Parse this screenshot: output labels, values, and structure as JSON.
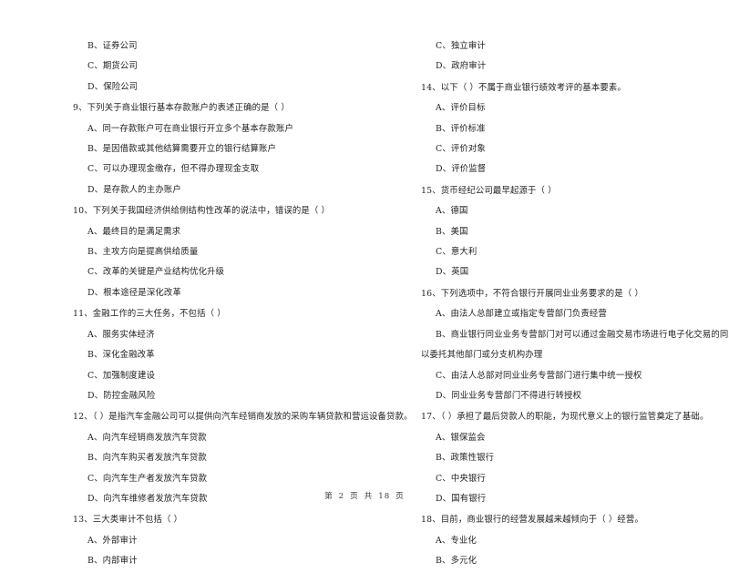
{
  "document": {
    "page_footer": {
      "prefix": "第",
      "current_page": "2",
      "unit_1": "页",
      "middle": "共",
      "total_pages": "18",
      "unit_2": "页"
    }
  },
  "left_column": {
    "orphan_options": [
      "B、证券公司",
      "C、期货公司",
      "D、保险公司"
    ],
    "questions": [
      {
        "number": "9、",
        "stem": "下列关于商业银行基本存款账户的表述正确的是（       ）",
        "options": [
          "A、同一存款账户可在商业银行开立多个基本存款账户",
          "B、是因借款或其他结算需要开立的银行结算账户",
          "C、可以办理现金缴存，但不得办理现金支取",
          "D、是存款人的主办账户"
        ]
      },
      {
        "number": "10、",
        "stem": "下列关于我国经济供给侧结构性改革的说法中，错误的是（       ）",
        "options": [
          "A、最终目的是满足需求",
          "B、主攻方向是提高供给质量",
          "C、改革的关键是产业结构优化升级",
          "D、根本途径是深化改革"
        ]
      },
      {
        "number": "11、",
        "stem": "金融工作的三大任务，不包括（       ）",
        "options": [
          "A、服务实体经济",
          "B、深化金融改革",
          "C、加强制度建设",
          "D、防控金融风险"
        ]
      },
      {
        "number": "12、",
        "stem": "（       ）是指汽车金融公司可以提供向汽车经销商发放的采购车辆贷款和营运设备贷款。",
        "options": [
          "A、向汽车经销商发放汽车贷款",
          "B、向汽车购买者发放汽车贷款",
          "C、向汽车生产者发放汽车贷款",
          "D、向汽车维修者发放汽车贷款"
        ]
      },
      {
        "number": "13、",
        "stem": "三大类审计不包括（       ）",
        "options": [
          "A、外部审计",
          "B、内部审计"
        ]
      }
    ]
  },
  "right_column": {
    "orphan_options": [
      "C、独立审计",
      "D、政府审计"
    ],
    "questions": [
      {
        "number": "14、",
        "stem": "以下（       ）不属于商业银行绩效考评的基本要素。",
        "options": [
          "A、评价目标",
          "B、评价标准",
          "C、评价对象",
          "D、评价监督"
        ]
      },
      {
        "number": "15、",
        "stem": "货币经纪公司最早起源于（       ）",
        "options": [
          "A、德国",
          "B、美国",
          "C、意大利",
          "D、英国"
        ]
      },
      {
        "number": "16、",
        "stem": "下列选项中，不符合银行开展同业业务要求的是（       ）",
        "options": [
          "A、由法人总部建立或指定专营部门负责经营",
          "B、商业银行同业业务专营部门对可以通过金融交易市场进行电子化交易的同业业务，可",
          "以委托其他部门或分支机构办理",
          "C、由法人总部对同业业务专营部门进行集中统一授权",
          "D、同业业务专营部门不得进行转授权"
        ]
      },
      {
        "number": "17、",
        "stem": "（       ）承担了最后贷款人的职能，为现代意义上的银行监管奠定了基础。",
        "options": [
          "A、银保监会",
          "B、政策性银行",
          "C、中央银行",
          "D、国有银行"
        ]
      },
      {
        "number": "18、",
        "stem": "目前，商业银行的经营发展越来越倾向于（       ）经营。",
        "options": [
          "A、专业化",
          "B、多元化"
        ]
      }
    ]
  }
}
